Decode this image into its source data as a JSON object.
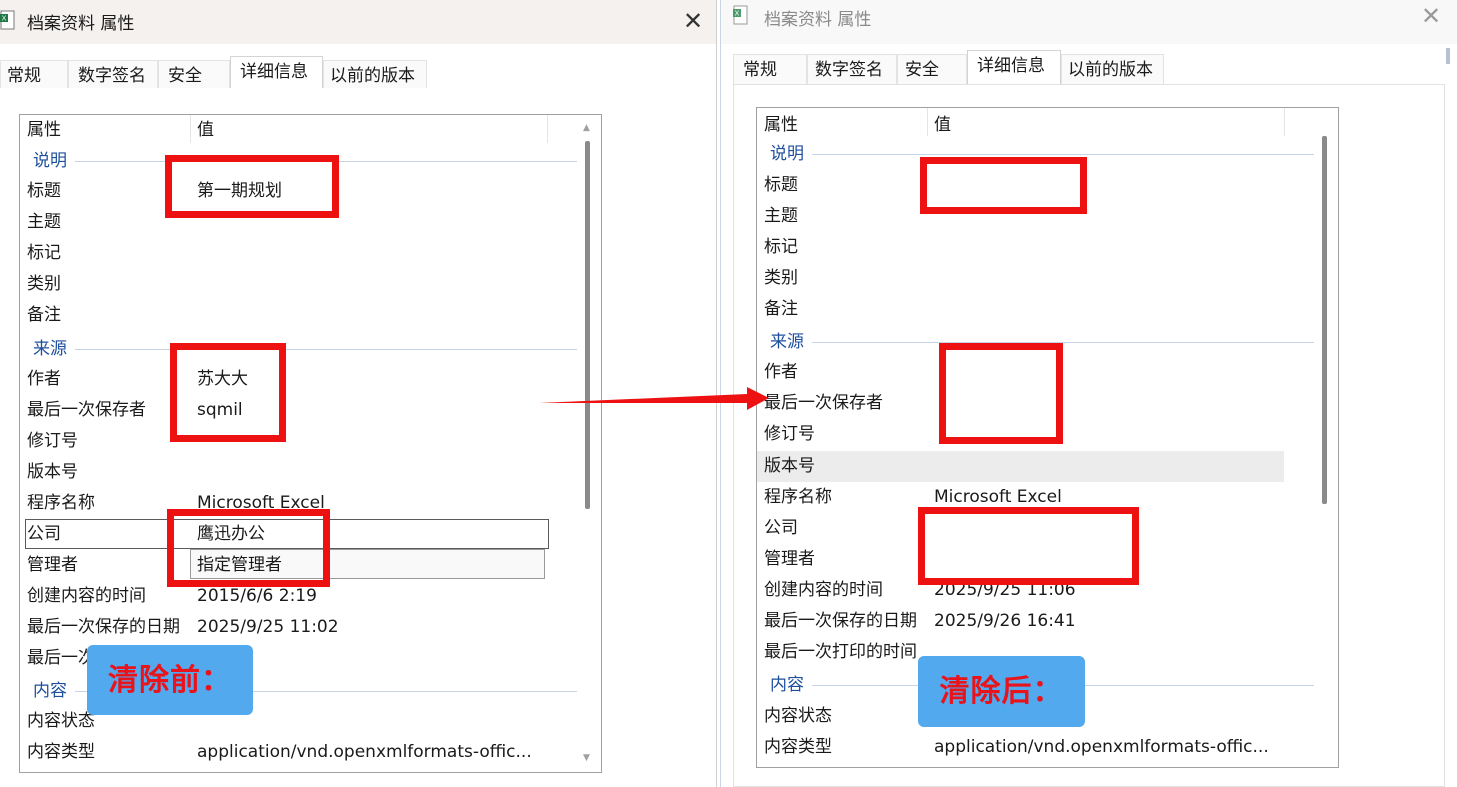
{
  "colors": {
    "accent_red": "#ee1111",
    "badge_blue": "#52a9ee",
    "group_blue": "#1d4f9c"
  },
  "left": {
    "title": "档案资料 属性",
    "close_glyph": "✕",
    "tabs": [
      "常规",
      "数字签名",
      "安全",
      "详细信息",
      "以前的版本"
    ],
    "header": {
      "property": "属性",
      "value": "值"
    },
    "groups": {
      "description": "说明",
      "origin": "来源",
      "content": "内容"
    },
    "rows": {
      "title": {
        "label": "标题",
        "value": "第一期规划"
      },
      "subject": {
        "label": "主题",
        "value": ""
      },
      "tags": {
        "label": "标记",
        "value": ""
      },
      "category": {
        "label": "类别",
        "value": ""
      },
      "comments": {
        "label": "备注",
        "value": ""
      },
      "author": {
        "label": "作者",
        "value": "苏大大"
      },
      "last_saved_by": {
        "label": "最后一次保存者",
        "value": "sqmil"
      },
      "revision": {
        "label": "修订号",
        "value": ""
      },
      "version": {
        "label": "版本号",
        "value": ""
      },
      "program": {
        "label": "程序名称",
        "value": "Microsoft Excel"
      },
      "company": {
        "label": "公司",
        "value": "鹰迅办公"
      },
      "manager": {
        "label": "管理者",
        "value": "指定管理者"
      },
      "created": {
        "label": "创建内容的时间",
        "value": "2015/6/6 2:19"
      },
      "last_saved": {
        "label": "最后一次保存的日期",
        "value": "2025/9/25 11:02"
      },
      "last_printed": {
        "label": "最后一次",
        "value": ""
      },
      "content_status": {
        "label": "内容状态",
        "value": ""
      },
      "content_type": {
        "label": "内容类型",
        "value": "application/vnd.openxmlformats-offic..."
      }
    },
    "badge": "清除前："
  },
  "right": {
    "title": "档案资料 属性",
    "close_glyph": "✕",
    "tabs": [
      "常规",
      "数字签名",
      "安全",
      "详细信息",
      "以前的版本"
    ],
    "header": {
      "property": "属性",
      "value": "值"
    },
    "groups": {
      "description": "说明",
      "origin": "来源",
      "content": "内容"
    },
    "rows": {
      "title": {
        "label": "标题",
        "value": ""
      },
      "subject": {
        "label": "主题",
        "value": ""
      },
      "tags": {
        "label": "标记",
        "value": ""
      },
      "category": {
        "label": "类别",
        "value": ""
      },
      "comments": {
        "label": "备注",
        "value": ""
      },
      "author": {
        "label": "作者",
        "value": ""
      },
      "last_saved_by": {
        "label": "最后一次保存者",
        "value": ""
      },
      "revision": {
        "label": "修订号",
        "value": ""
      },
      "version": {
        "label": "版本号",
        "value": ""
      },
      "program": {
        "label": "程序名称",
        "value": "Microsoft Excel"
      },
      "company": {
        "label": "公司",
        "value": ""
      },
      "manager": {
        "label": "管理者",
        "value": ""
      },
      "created": {
        "label": "创建内容的时间",
        "value": "2025/9/25 11:06"
      },
      "last_saved": {
        "label": "最后一次保存的日期",
        "value": "2025/9/26 16:41"
      },
      "last_printed": {
        "label": "最后一次打印的时间",
        "value": ""
      },
      "content_status": {
        "label": "内容状态",
        "value": ""
      },
      "content_type": {
        "label": "内容类型",
        "value": "application/vnd.openxmlformats-offic..."
      }
    },
    "badge": "清除后："
  }
}
